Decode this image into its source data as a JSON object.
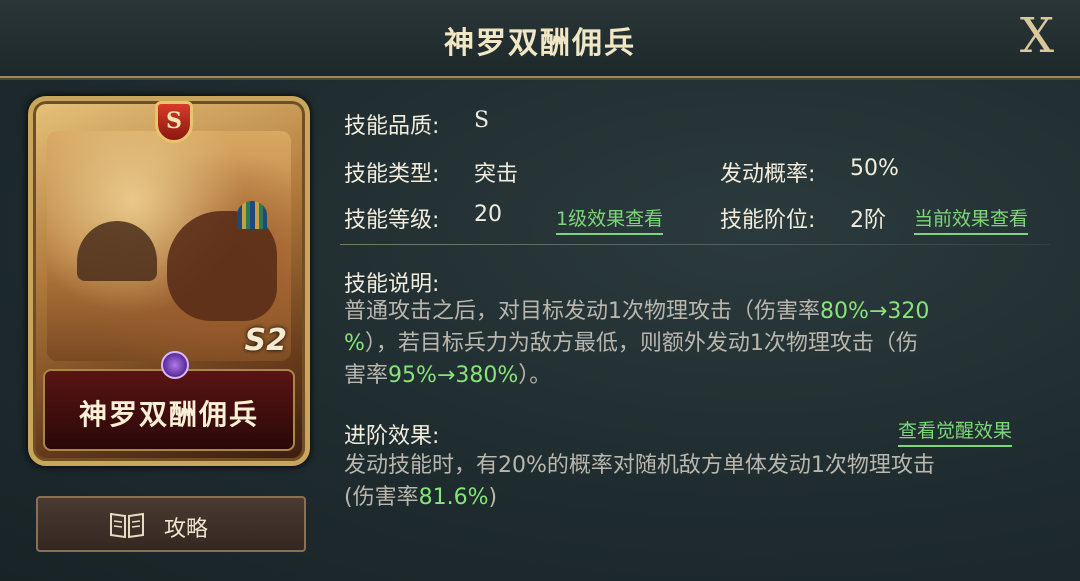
{
  "header": {
    "title": "神罗双酬佣兵",
    "close_label": "X"
  },
  "card": {
    "grade": "S",
    "season": "S2",
    "name": "神罗双酬佣兵"
  },
  "guide_button": {
    "label": "攻略",
    "icon": "book-icon"
  },
  "skill": {
    "quality_label": "技能品质:",
    "quality_value": "S",
    "type_label": "技能类型:",
    "type_value": "突击",
    "trigger_label": "发动概率:",
    "trigger_value": "50%",
    "level_label": "技能等级:",
    "level_value": "20",
    "level_link": "1级效果查看",
    "tier_label": "技能阶位:",
    "tier_value": "2阶",
    "tier_link": "当前效果查看",
    "desc_label": "技能说明:",
    "desc_line1_a": "普通攻击之后，对目标发动1次物理攻击（伤害率",
    "desc_line1_hl": "80%→320",
    "desc_line2_hl": "%",
    "desc_line2_b": "），若目标兵力为敌方最低，则额外发动1次物理攻击（伤",
    "desc_line3_a": "害率",
    "desc_line3_hl": "95%→380%",
    "desc_line3_b": "）。",
    "advance_label": "进阶效果:",
    "advance_link": "查看觉醒效果",
    "advance_line1": "发动技能时，有20%的概率对随机敌方单体发动1次物理攻击",
    "advance_line2_a": "(伤害率",
    "advance_line2_hl": "81.6%",
    "advance_line2_b": ")"
  },
  "colors": {
    "accent_green": "#7ed67a",
    "gold_frame": "#c8a65c"
  }
}
